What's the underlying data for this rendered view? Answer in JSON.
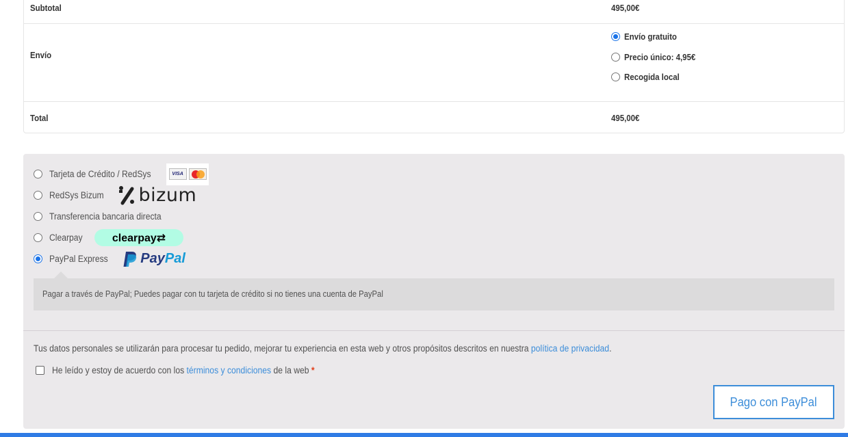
{
  "totals": {
    "subtotal_label": "Subtotal",
    "subtotal_value": "495,00€",
    "shipping_label": "Envío",
    "shipping_options": [
      {
        "label": "Envío gratuito",
        "selected": true
      },
      {
        "label": "Precio único: 4,95€",
        "selected": false
      },
      {
        "label": "Recogida local",
        "selected": false
      }
    ],
    "total_label": "Total",
    "total_value": "495,00€"
  },
  "payment": {
    "methods": [
      {
        "label": "Tarjeta de Crédito / RedSys",
        "selected": false,
        "logo": "visa-mastercard-icon"
      },
      {
        "label": "RedSys Bizum",
        "selected": false,
        "logo": "bizum-logo"
      },
      {
        "label": "Transferencia bancaria directa",
        "selected": false
      },
      {
        "label": "Clearpay",
        "selected": false,
        "logo": "clearpay-logo"
      },
      {
        "label": "PayPal Express",
        "selected": true,
        "logo": "paypal-logo"
      }
    ],
    "logos": {
      "visa": "VISA",
      "bizum": "bizum",
      "clearpay": "clearpay⇄",
      "paypal_a": "Pay",
      "paypal_b": "Pal"
    },
    "description": "Pagar a través de PayPal; Puedes pagar con tu tarjeta de crédito si no tienes una cuenta de PayPal",
    "privacy_text": "Tus datos personales se utilizarán para procesar tu pedido, mejorar tu experiencia en esta web y otros propósitos descritos en nuestra ",
    "privacy_link": "política de privacidad",
    "privacy_end": ".",
    "terms_text": "He leído y estoy de acuerdo con los ",
    "terms_link": "términos y condiciones",
    "terms_end": " de la web ",
    "required_mark": "*",
    "button_label": "Pago con PayPal"
  },
  "colors": {
    "accent": "#3c8dd9",
    "radio_selected": "#1a73e8",
    "payment_bg": "#ebe9eb",
    "bottom_bar": "#2f7be5"
  }
}
